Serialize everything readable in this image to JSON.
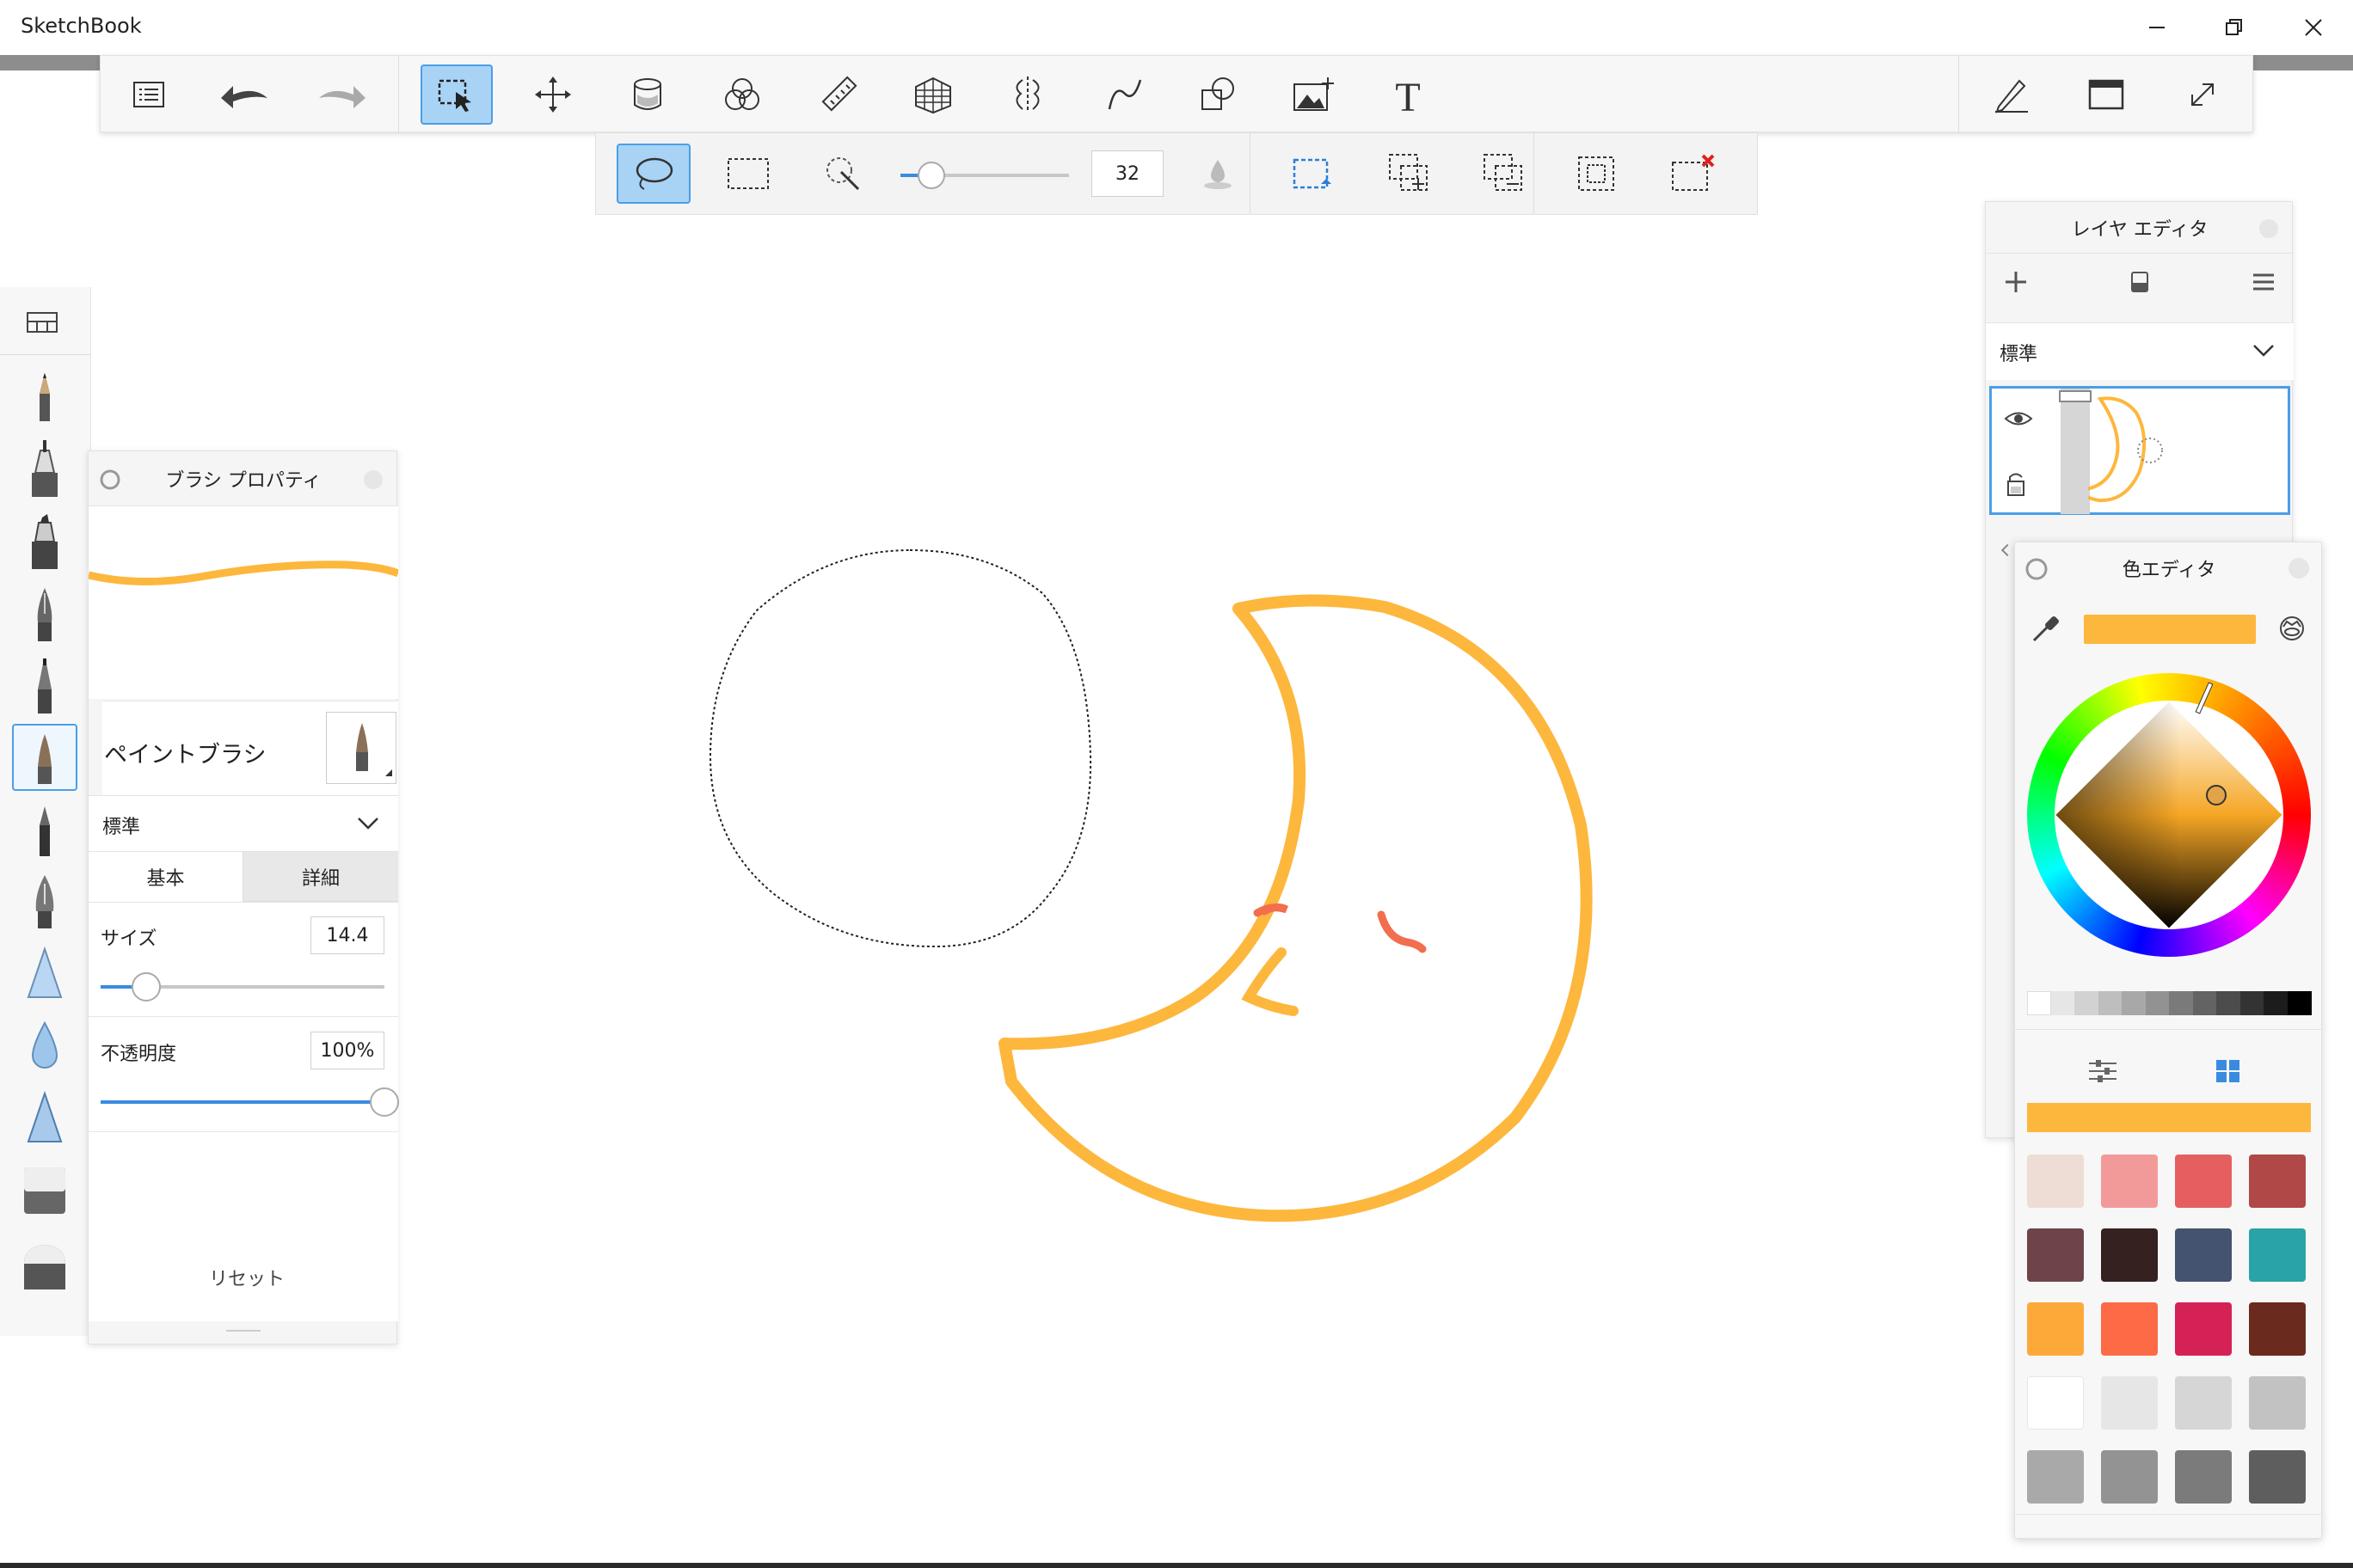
{
  "window": {
    "title": "SketchBook",
    "minimize_icon": "minimize-icon",
    "restore_icon": "restore-icon",
    "close_icon": "close-icon"
  },
  "toolbar": {
    "items": [
      {
        "name": "lagoon-menu-icon"
      },
      {
        "name": "undo-icon"
      },
      {
        "name": "redo-icon"
      },
      {
        "name": "select-tool-icon",
        "active": true
      },
      {
        "name": "transform-icon"
      },
      {
        "name": "fill-bucket-icon"
      },
      {
        "name": "blend-modes-icon"
      },
      {
        "name": "ruler-icon"
      },
      {
        "name": "perspective-grid-icon"
      },
      {
        "name": "symmetry-icon"
      },
      {
        "name": "curve-stroke-icon"
      },
      {
        "name": "shapes-icon"
      },
      {
        "name": "add-image-icon"
      },
      {
        "name": "text-tool-icon"
      },
      {
        "name": "pen-settings-icon"
      },
      {
        "name": "window-layout-icon"
      },
      {
        "name": "fullscreen-icon"
      }
    ]
  },
  "selection_bar": {
    "feather_value": "32",
    "modes": [
      "lasso-select-icon",
      "rect-select-icon",
      "magic-wand-icon",
      "feather-drop-icon",
      "new-selection-icon",
      "add-selection-icon",
      "subtract-selection-icon",
      "invert-selection-icon",
      "clear-selection-icon"
    ]
  },
  "brush_panel": {
    "title": "ブラシ プロパティ",
    "brush_name": "ペイントブラシ",
    "mode": "標準",
    "tab_basic": "基本",
    "tab_detail": "詳細",
    "size_label": "サイズ",
    "size_value": "14.4",
    "size_fraction": 0.16,
    "opacity_label": "不透明度",
    "opacity_value": "100%",
    "opacity_fraction": 1.0,
    "reset_label": "リセット",
    "stroke_color": "#FDB73D"
  },
  "layer_panel": {
    "title": "レイヤ エディタ",
    "blend_mode": "標準",
    "add_icon": "plus-icon",
    "merge_icon": "layer-merge-icon",
    "menu_icon": "hamburger-menu-icon"
  },
  "color_panel": {
    "title": "色エディタ",
    "current_color": "#FDB73D",
    "grays": [
      "#ffffff",
      "#e6e6e6",
      "#d2d2d2",
      "#bebebe",
      "#a8a8a8",
      "#929292",
      "#7a7a7a",
      "#636363",
      "#4c4c4c",
      "#333333",
      "#1c1c1c",
      "#000000"
    ],
    "swatches": [
      "#EEDDD4",
      "#F29A9A",
      "#E65F5F",
      "#B04848",
      "#6E4448",
      "#352220",
      "#445370",
      "#2AA3A6",
      "#FDA93A",
      "#FD6A46",
      "#D42256",
      "#6B2A1E",
      "#FFFFFF",
      "#E6E6E6",
      "#D6D6D6",
      "#C2C2C2",
      "#A9A9A9",
      "#939393",
      "#7B7B7B",
      "#5E5E5E"
    ]
  },
  "canvas": {
    "moon_color": "#FDB73D",
    "face_color": "#F26E4E"
  }
}
